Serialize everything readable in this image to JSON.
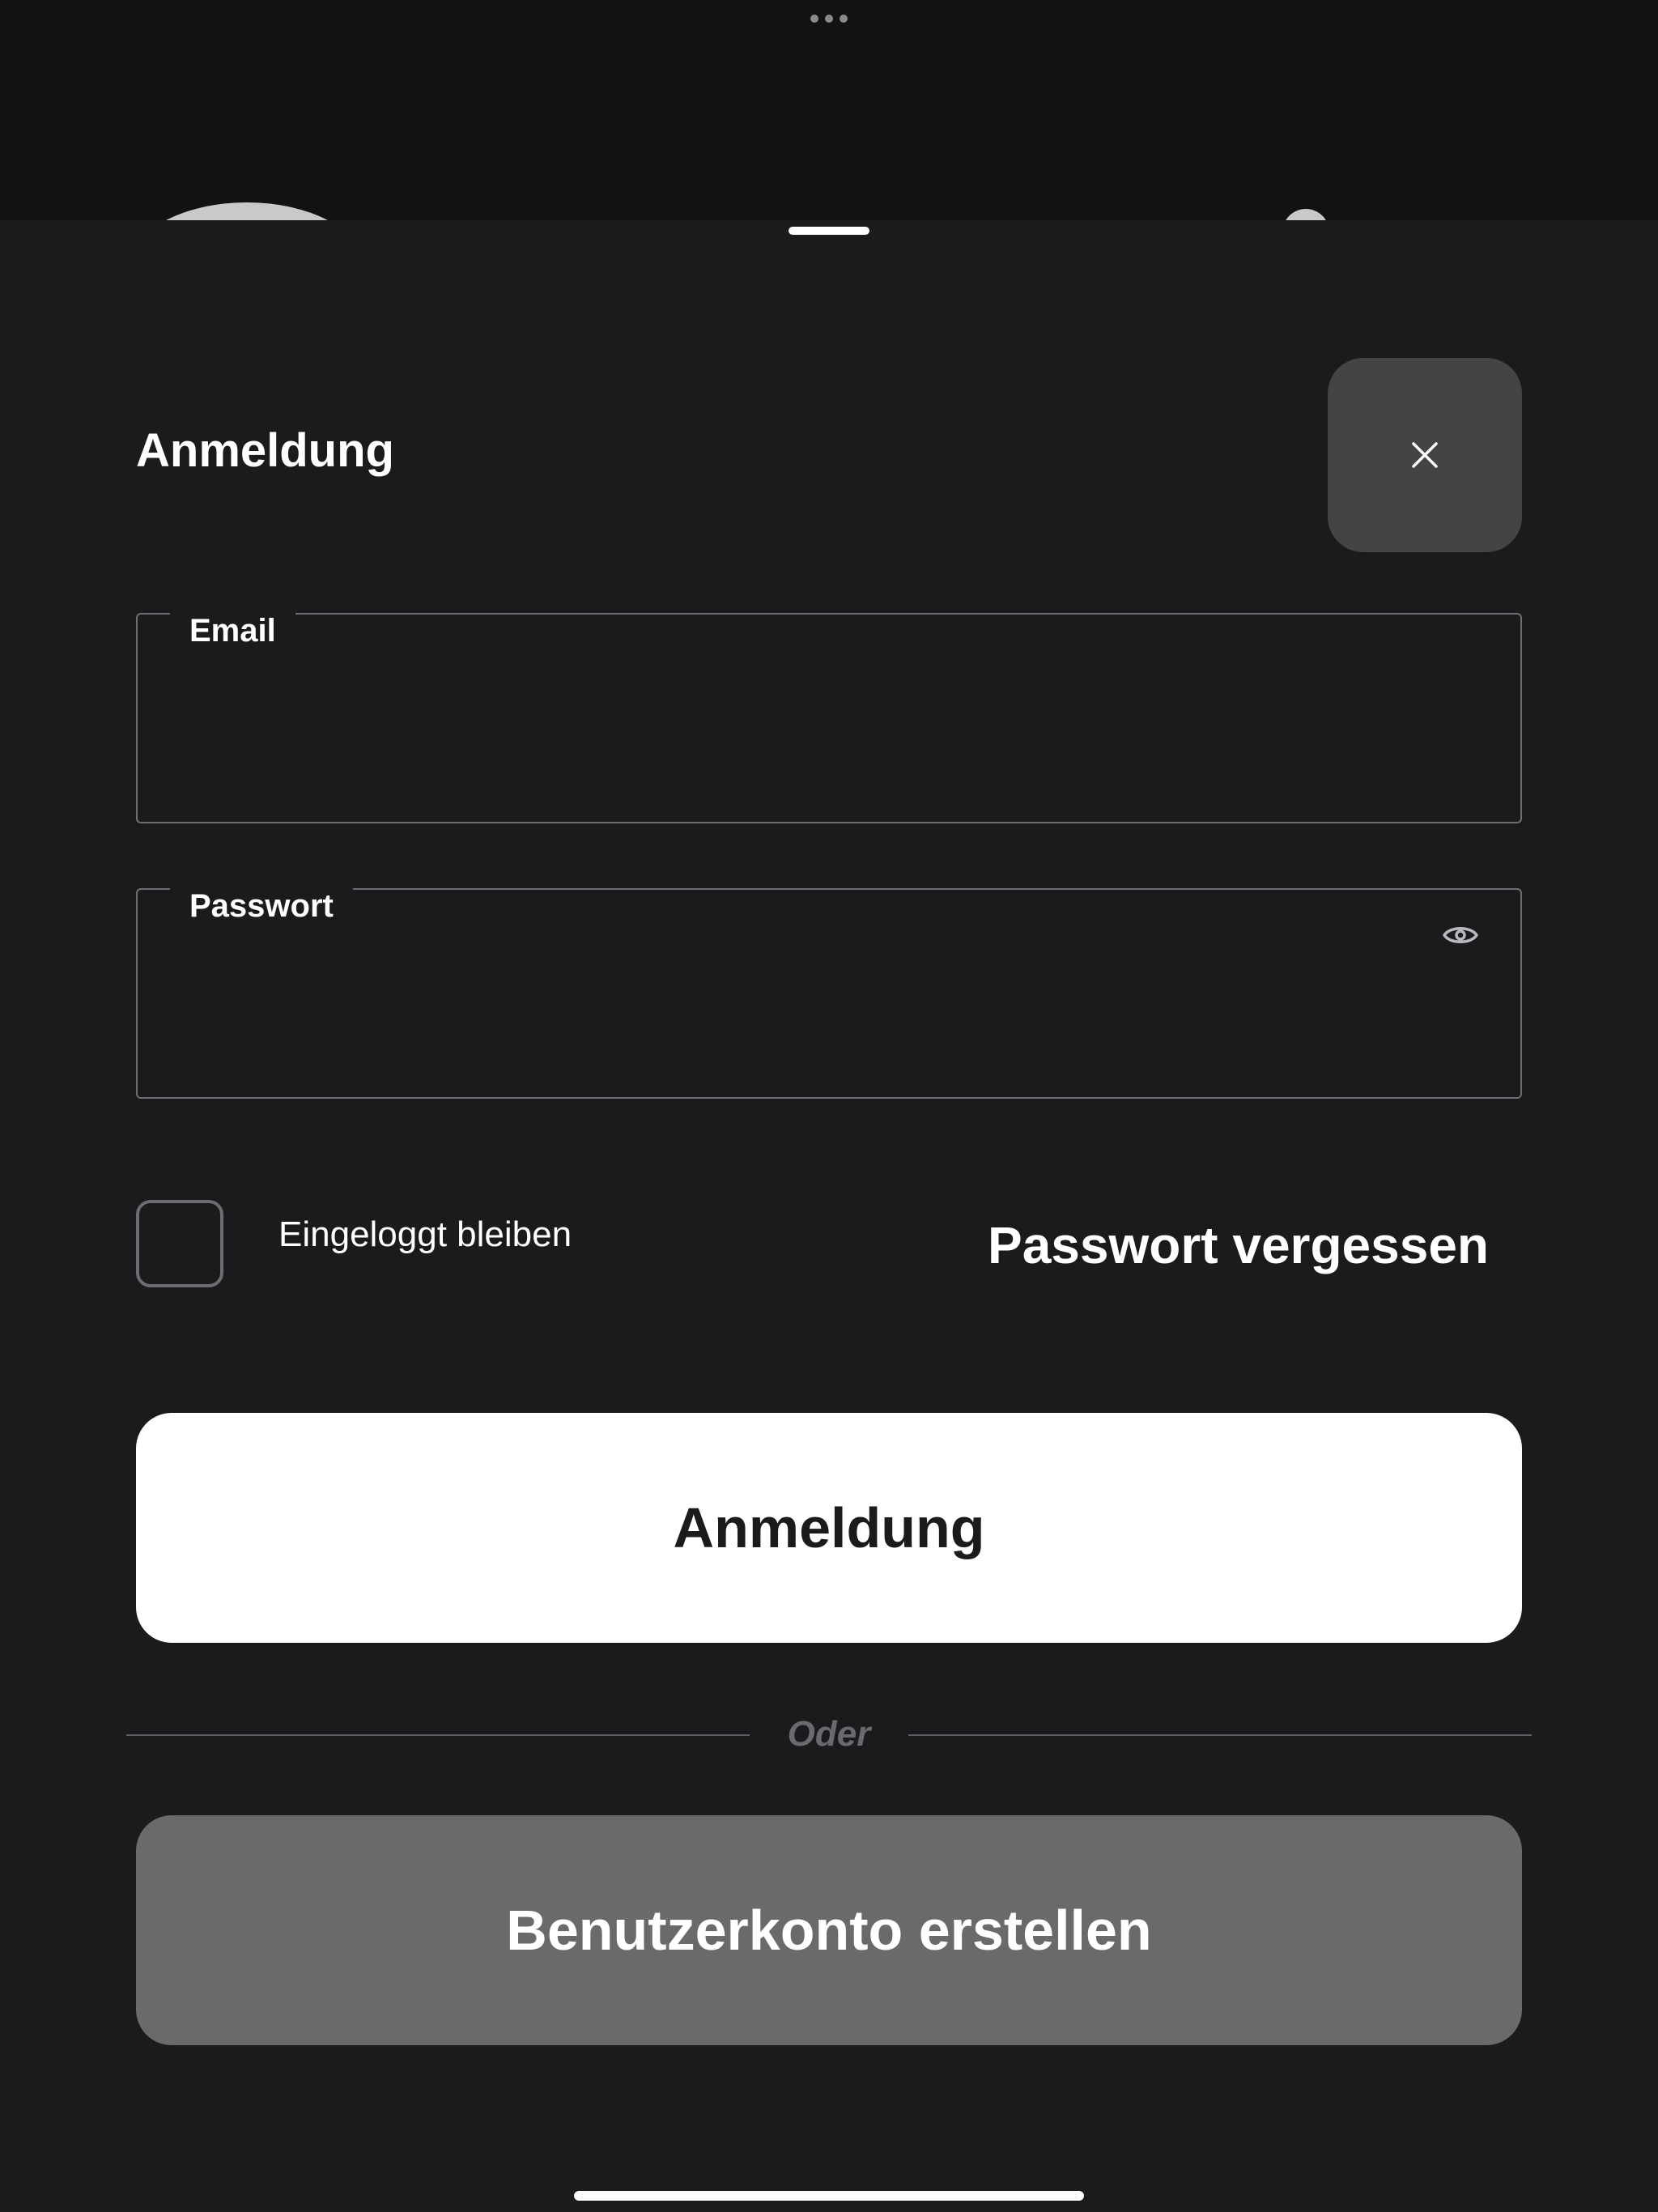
{
  "sheet": {
    "title": "Anmeldung"
  },
  "form": {
    "email": {
      "label": "Email",
      "value": "",
      "placeholder": ""
    },
    "password": {
      "label": "Passwort",
      "value": "",
      "placeholder": ""
    },
    "remember": {
      "label": "Eingeloggt bleiben",
      "checked": false
    },
    "forgot_password_label": "Passwort vergessen"
  },
  "actions": {
    "login_label": "Anmeldung",
    "divider_label": "Oder",
    "create_account_label": "Benutzerkonto erstellen"
  },
  "icons": {
    "close": "close-icon",
    "show_password": "eye-icon"
  },
  "colors": {
    "background": "#1b1a1c",
    "primary_button": "#ffffff",
    "secondary_button": "#6a696b",
    "close_button": "#454345",
    "field_border": "#6f6e72"
  }
}
